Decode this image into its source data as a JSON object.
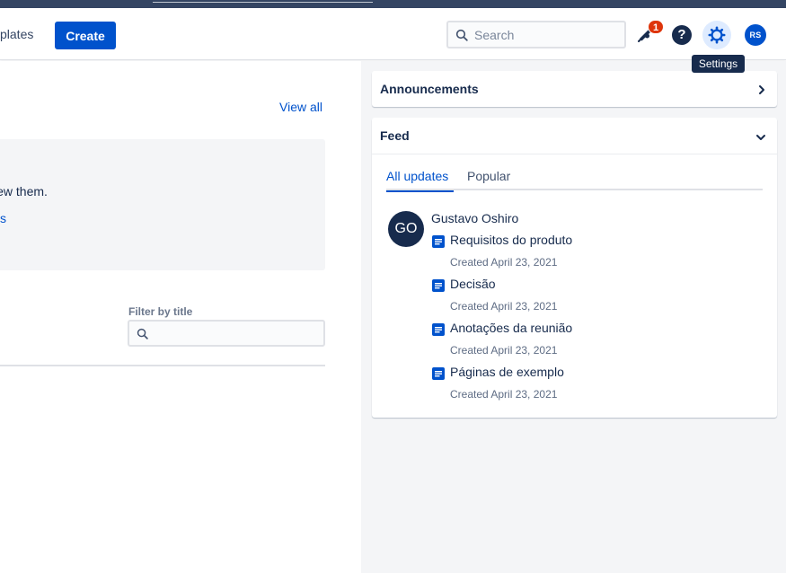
{
  "header": {
    "nav_partial": "plates",
    "create_label": "Create",
    "search_placeholder": "Search",
    "notifications_count": "1",
    "help_glyph": "?",
    "avatar_initials": "RS",
    "tooltip": "Settings",
    "icons": [
      "search-icon",
      "bell-icon",
      "help-icon",
      "gear-icon"
    ]
  },
  "main": {
    "view_all": "View all",
    "info_text": "view them.",
    "info_link": "s",
    "filter_label": "Filter by title",
    "filter_placeholder": ""
  },
  "sidebar": {
    "announcements_title": "Announcements",
    "feed_title": "Feed",
    "tabs": [
      {
        "label": "All updates",
        "active": true
      },
      {
        "label": "Popular",
        "active": false
      }
    ],
    "feed": {
      "user_initials": "GO",
      "user_name": "Gustavo Oshiro",
      "items": [
        {
          "title": "Requisitos do produto",
          "meta": "Created April 23, 2021"
        },
        {
          "title": "Decisão",
          "meta": "Created April 23, 2021"
        },
        {
          "title": "Anotações da reunião",
          "meta": "Created April 23, 2021"
        },
        {
          "title": "Páginas de exemplo",
          "meta": "Created April 23, 2021"
        }
      ]
    }
  },
  "colors": {
    "primary": "#0052CC",
    "text": "#172B4D",
    "muted": "#5E6C84",
    "badge": "#DE350B",
    "panel_bg": "#F4F5F7"
  }
}
